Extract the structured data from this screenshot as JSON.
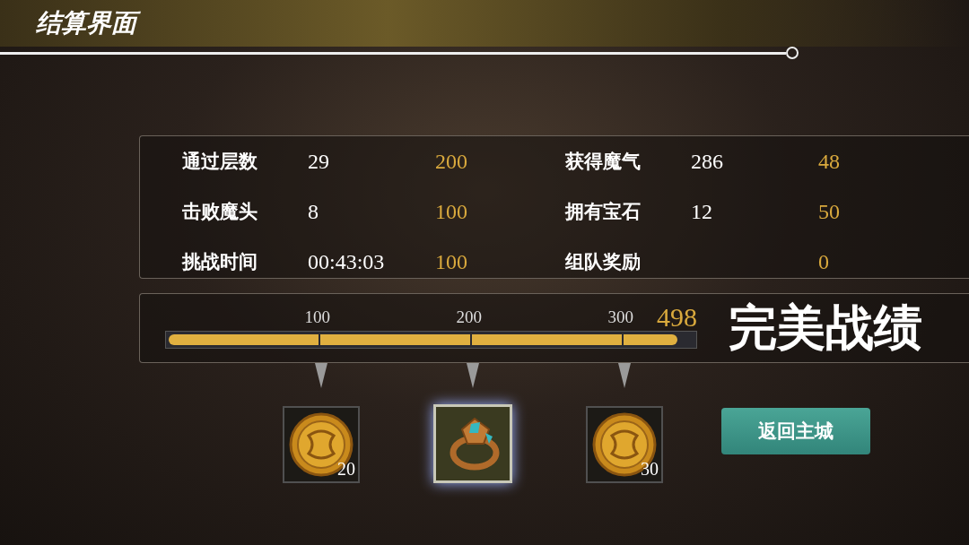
{
  "title": "结算界面",
  "stats": [
    {
      "label": "通过层数",
      "value": "29",
      "score": "200"
    },
    {
      "label": "击败魔头",
      "value": "8",
      "score": "100"
    },
    {
      "label": "挑战时间",
      "value": "00:43:03",
      "score": "100"
    },
    {
      "label": "获得魔气",
      "value": "286",
      "score": "48"
    },
    {
      "label": "拥有宝石",
      "value": "12",
      "score": "50"
    },
    {
      "label": "组队奖励",
      "score": "0"
    }
  ],
  "progress": {
    "ticks": [
      "100",
      "200",
      "300"
    ],
    "total": "498",
    "level": 0.97,
    "rating": "完美战绩"
  },
  "rewards": [
    {
      "kind": "coin",
      "count": "20",
      "selected": false
    },
    {
      "kind": "ring",
      "selected": true
    },
    {
      "kind": "coin",
      "count": "30",
      "selected": false
    }
  ],
  "button": "返回主城"
}
